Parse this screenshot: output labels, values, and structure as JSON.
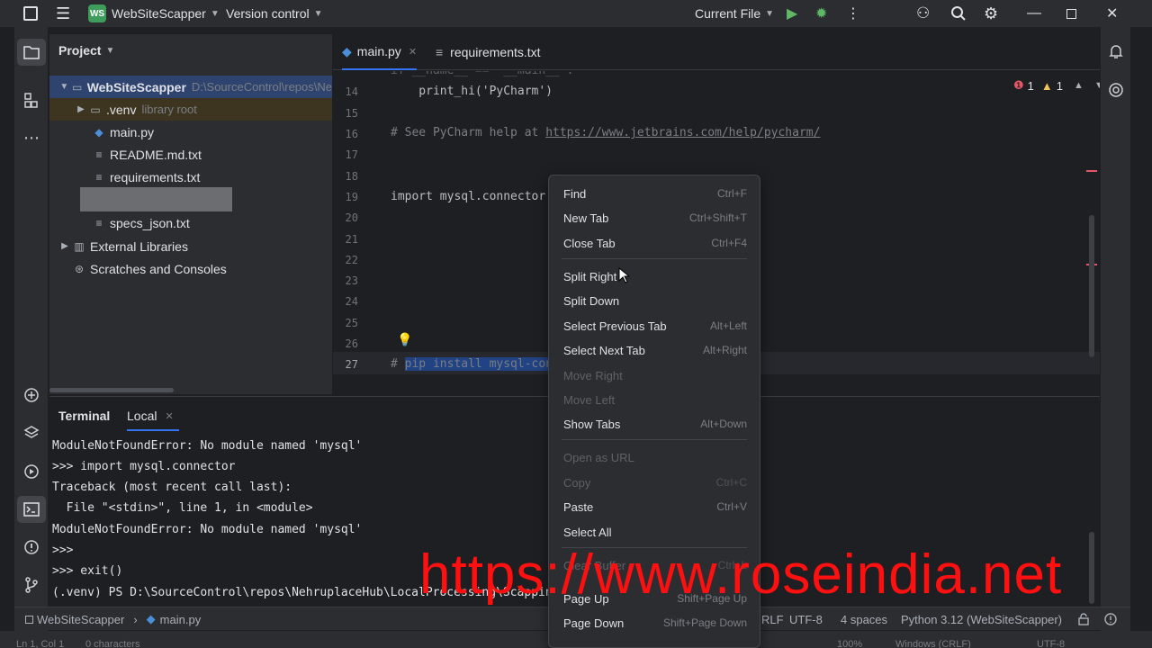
{
  "titlebar": {
    "project_badge": "WS",
    "project_name": "WebSiteScapper",
    "vcs": "Version control",
    "run_config": "Current File"
  },
  "project_panel": {
    "title": "Project",
    "items": [
      {
        "label": "WebSiteScapper",
        "extra": "D:\\SourceControl\\repos\\Ne"
      },
      {
        "label": ".venv",
        "extra": "library root"
      },
      {
        "label": "main.py"
      },
      {
        "label": "README.md.txt"
      },
      {
        "label": "requirements.txt"
      },
      {
        "label": "specs_json.txt"
      },
      {
        "label": "External Libraries"
      },
      {
        "label": "Scratches and Consoles"
      }
    ]
  },
  "editor": {
    "tabs": [
      {
        "label": "main.py"
      },
      {
        "label": "requirements.txt"
      }
    ],
    "errors": "1",
    "warnings": "1",
    "lines": [
      {
        "n": "14",
        "text": "    print_hi('PyCharm')"
      },
      {
        "n": "15",
        "text": ""
      },
      {
        "n": "16",
        "text": "# See PyCharm help at ",
        "link": "https://www.jetbrains.com/help/pycharm/"
      },
      {
        "n": "17",
        "text": ""
      },
      {
        "n": "18",
        "text": ""
      },
      {
        "n": "19",
        "text": "import mysql.connector"
      },
      {
        "n": "20",
        "text": ""
      },
      {
        "n": "21",
        "text": ""
      },
      {
        "n": "22",
        "text": ""
      },
      {
        "n": "23",
        "text": ""
      },
      {
        "n": "24",
        "text": ""
      },
      {
        "n": "25",
        "text": ""
      },
      {
        "n": "26",
        "text": ""
      },
      {
        "n": "27",
        "text": "# ",
        "selected": "pip install mysql-con"
      }
    ]
  },
  "terminal": {
    "tabs": [
      "Terminal",
      "Local"
    ],
    "lines": [
      "ModuleNotFoundError: No module named 'mysql'",
      ">>> import mysql.connector",
      "Traceback (most recent call last):",
      "  File \"<stdin>\", line 1, in <module>",
      "ModuleNotFoundError: No module named 'mysql'",
      ">>>",
      ">>> exit()",
      "(.venv) PS D:\\SourceControl\\repos\\NehruplaceHub\\LocalProcessing\\Scapping\\"
    ]
  },
  "context_menu": {
    "groups": [
      [
        {
          "label": "Find",
          "shortcut": "Ctrl+F",
          "enabled": true
        },
        {
          "label": "New Tab",
          "shortcut": "Ctrl+Shift+T",
          "enabled": true
        },
        {
          "label": "Close Tab",
          "shortcut": "Ctrl+F4",
          "enabled": true
        }
      ],
      [
        {
          "label": "Split Right",
          "shortcut": "",
          "enabled": true
        },
        {
          "label": "Split Down",
          "shortcut": "",
          "enabled": true
        },
        {
          "label": "Select Previous Tab",
          "shortcut": "Alt+Left",
          "enabled": true
        },
        {
          "label": "Select Next Tab",
          "shortcut": "Alt+Right",
          "enabled": true
        },
        {
          "label": "Move Right",
          "shortcut": "",
          "enabled": false
        },
        {
          "label": "Move Left",
          "shortcut": "",
          "enabled": false
        },
        {
          "label": "Show Tabs",
          "shortcut": "Alt+Down",
          "enabled": true
        }
      ],
      [
        {
          "label": "Open as URL",
          "shortcut": "",
          "enabled": false
        },
        {
          "label": "Copy",
          "shortcut": "Ctrl+C",
          "enabled": false
        },
        {
          "label": "Paste",
          "shortcut": "Ctrl+V",
          "enabled": true
        },
        {
          "label": "Select All",
          "shortcut": "",
          "enabled": true
        }
      ],
      [
        {
          "label": "Clear Buffer",
          "shortcut": "Ctrl+L",
          "enabled": false
        },
        {
          "label": "Page Up",
          "shortcut": "Shift+Page Up",
          "enabled": true
        },
        {
          "label": "Page Down",
          "shortcut": "Shift+Page Down",
          "enabled": true
        }
      ]
    ]
  },
  "statusbar": {
    "breadcrumb_project": "WebSiteScapper",
    "breadcrumb_file": "main.py",
    "line_sep": "RLF",
    "encoding": "UTF-8",
    "indent": "4 spaces",
    "interpreter": "Python 3.12 (WebSiteScapper)"
  },
  "bottom_strip": {
    "position": "Ln 1, Col 1",
    "chars": "0 characters",
    "zoom": "100%",
    "os": "Windows (CRLF)",
    "enc": "UTF-8"
  },
  "watermark": "https://www.roseindia.net",
  "icons": {
    "run": "run-icon",
    "debug": "debug-icon",
    "more": "more-icon",
    "add_user": "add-user-icon",
    "search": "search-icon",
    "settings": "gear-icon"
  }
}
